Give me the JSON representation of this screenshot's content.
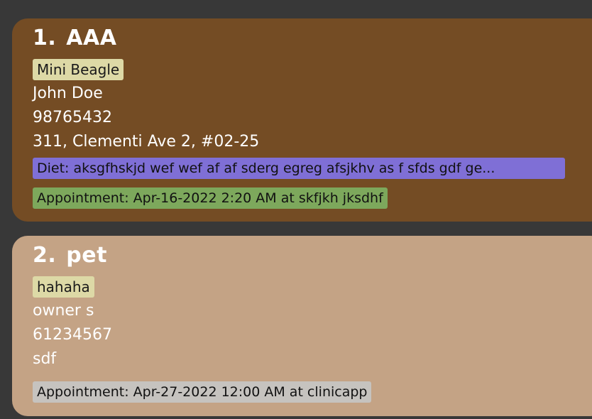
{
  "pets": [
    {
      "index": "1.",
      "name": "AAA",
      "tag": "Mini Beagle",
      "owner": "John Doe",
      "phone": "98765432",
      "address": "311, Clementi Ave 2, #02-25",
      "diet": "Diet: aksgfhskjd wef wef af af sderg egreg afsjkhv as f sfds gdf ge...",
      "appointment": "Appointment: Apr-16-2022 2:20 AM at skfjkh jksdhf",
      "colors": {
        "card": "#744c24",
        "diet": "#7f6fd6",
        "appointment": "#7da85c"
      }
    },
    {
      "index": "2.",
      "name": "pet",
      "tag": "hahaha",
      "owner": "owner s",
      "phone": "61234567",
      "address": "sdf",
      "appointment": "Appointment: Apr-27-2022 12:00 AM at clinicapp",
      "colors": {
        "card": "#c4a385",
        "appointment": "#c6c3bf"
      }
    }
  ],
  "colors": {
    "background": "#383838",
    "tag": "#ddd9a6",
    "text": "#ffffff"
  }
}
